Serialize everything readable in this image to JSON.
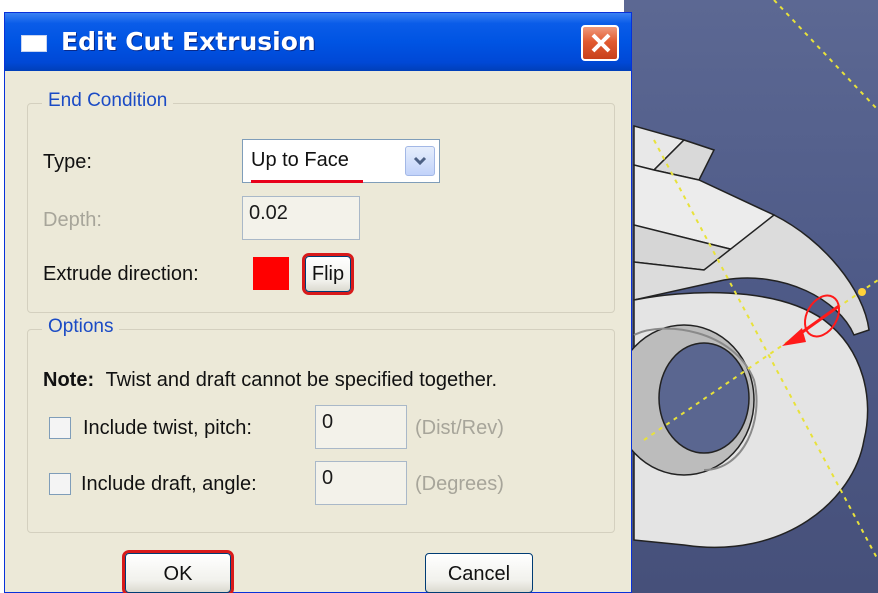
{
  "dialog": {
    "title": "Edit Cut Extrusion",
    "close_icon": "close-x-icon"
  },
  "end_condition": {
    "group_title": "End Condition",
    "type_label": "Type:",
    "type_value": "Up to Face",
    "depth_label": "Depth:",
    "depth_value": "0.02",
    "extrude_direction_label": "Extrude direction:",
    "direction_color": "#ff0000",
    "flip_label": "Flip"
  },
  "options": {
    "group_title": "Options",
    "note_bold": "Note:",
    "note_text": "Twist and draft cannot be specified together.",
    "twist_label": "Include twist, pitch:",
    "twist_value": "0",
    "twist_unit": "(Dist/Rev)",
    "draft_label": "Include draft, angle:",
    "draft_value": "0",
    "draft_unit": "(Degrees)"
  },
  "buttons": {
    "ok": "OK",
    "cancel": "Cancel"
  },
  "colors": {
    "highlight": "#d81a1a",
    "title_bar": "#0054e3",
    "viewport_bg": "#5c6893"
  }
}
